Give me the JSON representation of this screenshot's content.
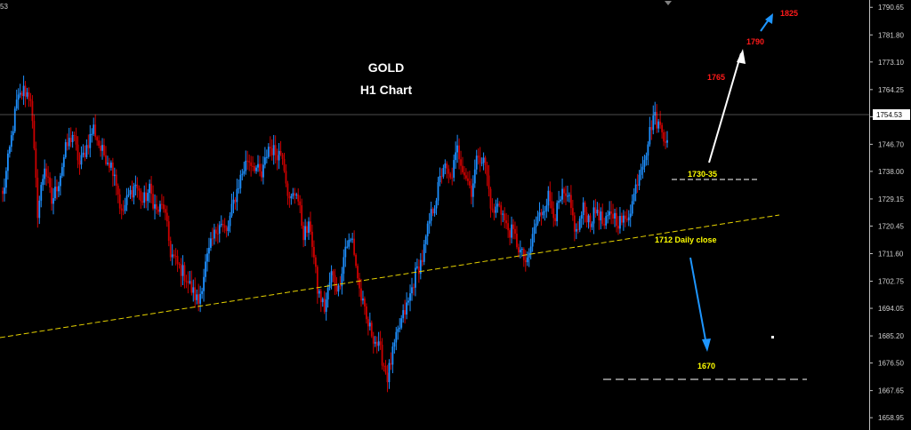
{
  "chart_data": {
    "type": "candlestick",
    "title": "GOLD",
    "subtitle": "H1 Chart",
    "corner_label": "53",
    "current_price": 1754.53,
    "current_price_label": "1754.53",
    "ylim": [
      1655,
      1793
    ],
    "y_ticks": [
      "1790.65",
      "1781.80",
      "1773.10",
      "1764.25",
      "1755.55",
      "1746.70",
      "1738.00",
      "1729.15",
      "1720.45",
      "1711.60",
      "1702.75",
      "1694.05",
      "1685.20",
      "1676.50",
      "1667.65",
      "1658.95"
    ],
    "colors": {
      "up": "#1e90ff",
      "down": "#cc0000",
      "trendline": "#e6d200",
      "level_line": "#ffffff",
      "annotation_yellow": "#ffff00",
      "annotation_red": "#ff1a1a",
      "arrow_white": "#ffffff",
      "arrow_blue": "#1e96ff"
    },
    "path": [
      1730,
      1745,
      1760,
      1764,
      1762,
      1725,
      1740,
      1728,
      1735,
      1745,
      1750,
      1740,
      1746,
      1752,
      1745,
      1742,
      1738,
      1724,
      1730,
      1734,
      1728,
      1732,
      1725,
      1727,
      1712,
      1708,
      1705,
      1700,
      1696,
      1708,
      1716,
      1722,
      1718,
      1728,
      1736,
      1742,
      1740,
      1736,
      1746,
      1744,
      1744,
      1728,
      1732,
      1718,
      1720,
      1700,
      1694,
      1705,
      1700,
      1714,
      1716,
      1700,
      1690,
      1685,
      1680,
      1672,
      1682,
      1690,
      1696,
      1705,
      1710,
      1722,
      1730,
      1740,
      1735,
      1745,
      1738,
      1732,
      1744,
      1740,
      1724,
      1728,
      1720,
      1718,
      1712,
      1708,
      1720,
      1725,
      1730,
      1724,
      1730,
      1728,
      1718,
      1726,
      1722,
      1726,
      1720,
      1725,
      1722,
      1722,
      1728,
      1738,
      1745,
      1756,
      1752,
      1748
    ],
    "annotations": {
      "target_1825": "1825",
      "target_1790": "1790",
      "target_1765": "1765",
      "level_1730": "1730-35",
      "daily_close": "1712 Daily close",
      "target_1670": "1670"
    }
  }
}
